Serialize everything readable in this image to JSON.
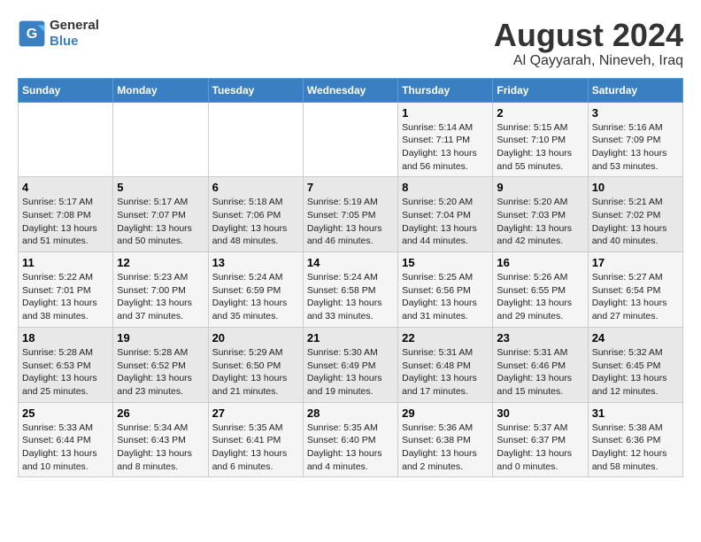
{
  "logo": {
    "general": "General",
    "blue": "Blue"
  },
  "title": "August 2024",
  "subtitle": "Al Qayyarah, Nineveh, Iraq",
  "days_of_week": [
    "Sunday",
    "Monday",
    "Tuesday",
    "Wednesday",
    "Thursday",
    "Friday",
    "Saturday"
  ],
  "weeks": [
    [
      {
        "day": "",
        "info": ""
      },
      {
        "day": "",
        "info": ""
      },
      {
        "day": "",
        "info": ""
      },
      {
        "day": "",
        "info": ""
      },
      {
        "day": "1",
        "info": "Sunrise: 5:14 AM\nSunset: 7:11 PM\nDaylight: 13 hours\nand 56 minutes."
      },
      {
        "day": "2",
        "info": "Sunrise: 5:15 AM\nSunset: 7:10 PM\nDaylight: 13 hours\nand 55 minutes."
      },
      {
        "day": "3",
        "info": "Sunrise: 5:16 AM\nSunset: 7:09 PM\nDaylight: 13 hours\nand 53 minutes."
      }
    ],
    [
      {
        "day": "4",
        "info": "Sunrise: 5:17 AM\nSunset: 7:08 PM\nDaylight: 13 hours\nand 51 minutes."
      },
      {
        "day": "5",
        "info": "Sunrise: 5:17 AM\nSunset: 7:07 PM\nDaylight: 13 hours\nand 50 minutes."
      },
      {
        "day": "6",
        "info": "Sunrise: 5:18 AM\nSunset: 7:06 PM\nDaylight: 13 hours\nand 48 minutes."
      },
      {
        "day": "7",
        "info": "Sunrise: 5:19 AM\nSunset: 7:05 PM\nDaylight: 13 hours\nand 46 minutes."
      },
      {
        "day": "8",
        "info": "Sunrise: 5:20 AM\nSunset: 7:04 PM\nDaylight: 13 hours\nand 44 minutes."
      },
      {
        "day": "9",
        "info": "Sunrise: 5:20 AM\nSunset: 7:03 PM\nDaylight: 13 hours\nand 42 minutes."
      },
      {
        "day": "10",
        "info": "Sunrise: 5:21 AM\nSunset: 7:02 PM\nDaylight: 13 hours\nand 40 minutes."
      }
    ],
    [
      {
        "day": "11",
        "info": "Sunrise: 5:22 AM\nSunset: 7:01 PM\nDaylight: 13 hours\nand 38 minutes."
      },
      {
        "day": "12",
        "info": "Sunrise: 5:23 AM\nSunset: 7:00 PM\nDaylight: 13 hours\nand 37 minutes."
      },
      {
        "day": "13",
        "info": "Sunrise: 5:24 AM\nSunset: 6:59 PM\nDaylight: 13 hours\nand 35 minutes."
      },
      {
        "day": "14",
        "info": "Sunrise: 5:24 AM\nSunset: 6:58 PM\nDaylight: 13 hours\nand 33 minutes."
      },
      {
        "day": "15",
        "info": "Sunrise: 5:25 AM\nSunset: 6:56 PM\nDaylight: 13 hours\nand 31 minutes."
      },
      {
        "day": "16",
        "info": "Sunrise: 5:26 AM\nSunset: 6:55 PM\nDaylight: 13 hours\nand 29 minutes."
      },
      {
        "day": "17",
        "info": "Sunrise: 5:27 AM\nSunset: 6:54 PM\nDaylight: 13 hours\nand 27 minutes."
      }
    ],
    [
      {
        "day": "18",
        "info": "Sunrise: 5:28 AM\nSunset: 6:53 PM\nDaylight: 13 hours\nand 25 minutes."
      },
      {
        "day": "19",
        "info": "Sunrise: 5:28 AM\nSunset: 6:52 PM\nDaylight: 13 hours\nand 23 minutes."
      },
      {
        "day": "20",
        "info": "Sunrise: 5:29 AM\nSunset: 6:50 PM\nDaylight: 13 hours\nand 21 minutes."
      },
      {
        "day": "21",
        "info": "Sunrise: 5:30 AM\nSunset: 6:49 PM\nDaylight: 13 hours\nand 19 minutes."
      },
      {
        "day": "22",
        "info": "Sunrise: 5:31 AM\nSunset: 6:48 PM\nDaylight: 13 hours\nand 17 minutes."
      },
      {
        "day": "23",
        "info": "Sunrise: 5:31 AM\nSunset: 6:46 PM\nDaylight: 13 hours\nand 15 minutes."
      },
      {
        "day": "24",
        "info": "Sunrise: 5:32 AM\nSunset: 6:45 PM\nDaylight: 13 hours\nand 12 minutes."
      }
    ],
    [
      {
        "day": "25",
        "info": "Sunrise: 5:33 AM\nSunset: 6:44 PM\nDaylight: 13 hours\nand 10 minutes."
      },
      {
        "day": "26",
        "info": "Sunrise: 5:34 AM\nSunset: 6:43 PM\nDaylight: 13 hours\nand 8 minutes."
      },
      {
        "day": "27",
        "info": "Sunrise: 5:35 AM\nSunset: 6:41 PM\nDaylight: 13 hours\nand 6 minutes."
      },
      {
        "day": "28",
        "info": "Sunrise: 5:35 AM\nSunset: 6:40 PM\nDaylight: 13 hours\nand 4 minutes."
      },
      {
        "day": "29",
        "info": "Sunrise: 5:36 AM\nSunset: 6:38 PM\nDaylight: 13 hours\nand 2 minutes."
      },
      {
        "day": "30",
        "info": "Sunrise: 5:37 AM\nSunset: 6:37 PM\nDaylight: 13 hours\nand 0 minutes."
      },
      {
        "day": "31",
        "info": "Sunrise: 5:38 AM\nSunset: 6:36 PM\nDaylight: 12 hours\nand 58 minutes."
      }
    ]
  ]
}
